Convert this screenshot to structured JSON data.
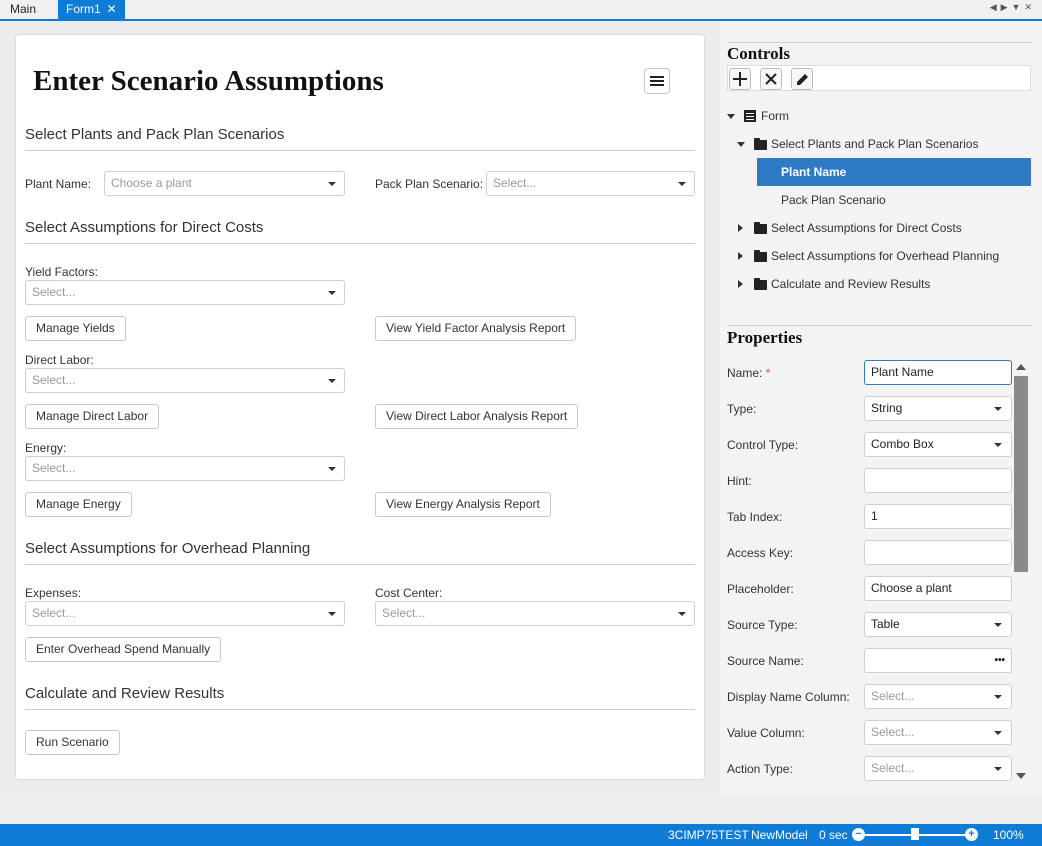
{
  "tabs": [
    {
      "label": "Main"
    },
    {
      "label": "Form1",
      "active": true,
      "close": "✕"
    }
  ],
  "form": {
    "title": "Enter Scenario Assumptions",
    "sections": {
      "plants": {
        "title": "Select Plants and Pack Plan Scenarios",
        "plant_label": "Plant Name:",
        "plant_placeholder": "Choose a plant",
        "pack_label": "Pack Plan Scenario:",
        "pack_placeholder": "Select..."
      },
      "direct": {
        "title": "Select Assumptions for Direct Costs",
        "yield_label": "Yield Factors:",
        "yield_placeholder": "Select...",
        "manage_yields": "Manage Yields",
        "view_yield_report": "View Yield Factor Analysis Report",
        "labor_label": "Direct Labor:",
        "labor_placeholder": "Select...",
        "manage_labor": "Manage Direct Labor",
        "view_labor_report": "View Direct Labor Analysis Report",
        "energy_label": "Energy:",
        "energy_placeholder": "Select...",
        "manage_energy": "Manage Energy",
        "view_energy_report": "View Energy Analysis Report"
      },
      "overhead": {
        "title": "Select Assumptions for Overhead Planning",
        "expenses_label": "Expenses:",
        "expenses_placeholder": "Select...",
        "cost_center_label": "Cost Center:",
        "cost_center_placeholder": "Select...",
        "enter_manual": "Enter Overhead Spend Manually"
      },
      "results": {
        "title": "Calculate and Review Results",
        "run": "Run Scenario"
      }
    }
  },
  "controls": {
    "title": "Controls",
    "tree": {
      "root": "Form",
      "section1": "Select Plants and Pack Plan Scenarios",
      "plant_name": "Plant Name",
      "pack_plan": "Pack Plan Scenario",
      "section2": "Select Assumptions for Direct Costs",
      "section3": "Select Assumptions for Overhead Planning",
      "section4": "Calculate and Review Results"
    }
  },
  "properties": {
    "title": "Properties",
    "name_label": "Name:",
    "required_mark": "*",
    "name_value": "Plant Name",
    "type_label": "Type:",
    "type_value": "String",
    "control_type_label": "Control Type:",
    "control_type_value": "Combo Box",
    "hint_label": "Hint:",
    "hint_value": "",
    "tab_index_label": "Tab Index:",
    "tab_index_value": "1",
    "access_key_label": "Access Key:",
    "access_key_value": "",
    "placeholder_label": "Placeholder:",
    "placeholder_value": "Choose a plant",
    "source_type_label": "Source Type:",
    "source_type_value": "Table",
    "source_name_label": "Source Name:",
    "source_name_value": "",
    "source_name_dots": "•••",
    "display_col_label": "Display Name Column:",
    "display_col_value": "Select...",
    "value_col_label": "Value Column:",
    "value_col_value": "Select...",
    "action_type_label": "Action Type:",
    "action_type_value": "Select..."
  },
  "status": {
    "server": "3CIMP75TEST",
    "model": "NewModel",
    "timer": "0 sec",
    "zoom": "100%",
    "zoom_level": 0.5
  },
  "colors": {
    "accent": "#0e7bd6",
    "selection": "#2f7ac4",
    "required": "#d9534f"
  }
}
